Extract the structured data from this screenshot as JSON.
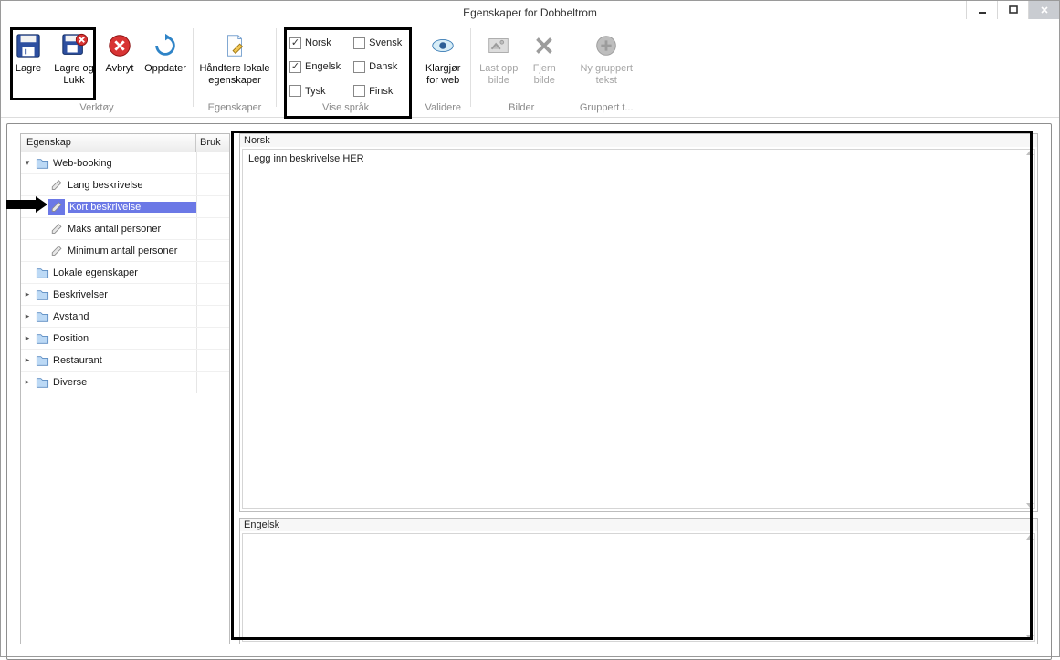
{
  "window_title": "Egenskaper for Dobbeltrom",
  "ribbon_groups": {
    "verktoy": {
      "label": "Verktøy",
      "save": "Lagre",
      "save_close": "Lagre og Lukk",
      "cancel": "Avbryt",
      "update": "Oppdater"
    },
    "egenskaper": {
      "label": "Egenskaper",
      "manage_local": "Håndtere lokale egenskaper"
    },
    "languages": {
      "label": "Vise språk",
      "norsk": "Norsk",
      "engelsk": "Engelsk",
      "tysk": "Tysk",
      "svensk": "Svensk",
      "dansk": "Dansk",
      "finsk": "Finsk"
    },
    "validere": {
      "label": "Validere",
      "prepare_web": "Klargjør for web"
    },
    "bilder": {
      "label": "Bilder",
      "upload": "Last opp bilde",
      "remove": "Fjern bilde"
    },
    "gruppert": {
      "label": "Gruppert t...",
      "new_group": "Ny gruppert tekst"
    }
  },
  "tree": {
    "header_prop": "Egenskap",
    "header_use": "Bruk",
    "web_booking": "Web-booking",
    "lang_beskrivelse": "Lang beskrivelse",
    "kort_beskrivelse": "Kort beskrivelse",
    "maks_personer": "Maks antall personer",
    "min_personer": "Minimum antall personer",
    "lokale": "Lokale egenskaper",
    "beskrivelser": "Beskrivelser",
    "avstand": "Avstand",
    "position": "Position",
    "restaurant": "Restaurant",
    "diverse": "Diverse"
  },
  "editors": {
    "norsk_label": "Norsk",
    "norsk_content": "Legg inn beskrivelse HER",
    "engelsk_label": "Engelsk",
    "engelsk_content": ""
  }
}
